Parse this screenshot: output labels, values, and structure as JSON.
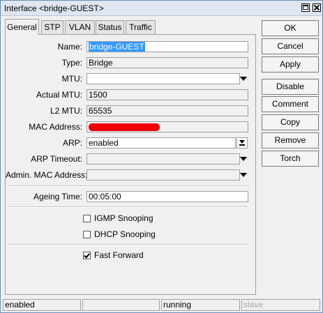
{
  "window": {
    "title": "Interface <bridge-GUEST>",
    "maximize_icon": "maximize-icon",
    "close_icon": "close-icon"
  },
  "tabs": [
    {
      "label": "General",
      "active": true
    },
    {
      "label": "STP",
      "active": false
    },
    {
      "label": "VLAN",
      "active": false
    },
    {
      "label": "Status",
      "active": false
    },
    {
      "label": "Traffic",
      "active": false
    }
  ],
  "form": {
    "name": {
      "label": "Name:",
      "value": "bridge-GUEST"
    },
    "type": {
      "label": "Type:",
      "value": "Bridge"
    },
    "mtu": {
      "label": "MTU:",
      "value": ""
    },
    "actual_mtu": {
      "label": "Actual MTU:",
      "value": "1500"
    },
    "l2_mtu": {
      "label": "L2 MTU:",
      "value": "65535"
    },
    "mac_address": {
      "label": "MAC Address:",
      "value": ""
    },
    "arp": {
      "label": "ARP:",
      "value": "enabled"
    },
    "arp_timeout": {
      "label": "ARP Timeout:",
      "value": ""
    },
    "admin_mac": {
      "label": "Admin. MAC Address:",
      "value": ""
    },
    "ageing_time": {
      "label": "Ageing Time:",
      "value": "00:05:00"
    },
    "igmp_snooping": {
      "label": "IGMP Snooping",
      "checked": false
    },
    "dhcp_snooping": {
      "label": "DHCP Snooping",
      "checked": false
    },
    "fast_forward": {
      "label": "Fast Forward",
      "checked": true
    }
  },
  "buttons": {
    "ok": "OK",
    "cancel": "Cancel",
    "apply": "Apply",
    "disable": "Disable",
    "comment": "Comment",
    "copy": "Copy",
    "remove": "Remove",
    "torch": "Torch"
  },
  "status": {
    "state": "enabled",
    "blank": "",
    "running": "running",
    "slave": "slave"
  },
  "colors": {
    "selection": "#3399ff",
    "redaction": "#ee0000",
    "titlebar": "#dfe6f1"
  }
}
